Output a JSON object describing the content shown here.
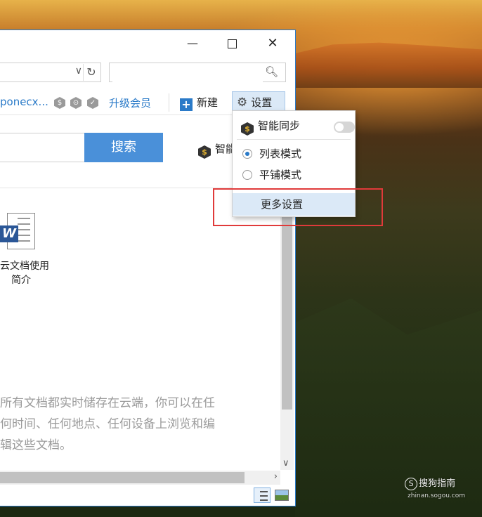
{
  "window": {
    "minimize_label": "—",
    "close_label": "✕"
  },
  "address_bar": {
    "value": "",
    "chevron": "∨",
    "refresh": "↻"
  },
  "search_bar": {
    "value": "",
    "placeholder": "",
    "icon": "search-icon"
  },
  "toolbar": {
    "user_name": "poneсx...",
    "badges": [
      "$",
      "⊙",
      "✓"
    ],
    "upgrade_label": "升级会员",
    "new_label": "新建",
    "settings_label": "设置"
  },
  "main": {
    "search_button_label": "搜索",
    "smart_label_partial": "智能",
    "coin_symbol": "$"
  },
  "document": {
    "icon_letter": "W",
    "caption_line1": "云文档使用",
    "caption_line2": "简介"
  },
  "info": {
    "line1": "所有文档都实时储存在云端，你可以在任",
    "line2": "何时间、任何地点、任何设备上浏览和编",
    "line3": "辑这些文档。"
  },
  "dropdown": {
    "sync_label": "智能同步",
    "sync_enabled": false,
    "list_mode_label": "列表模式",
    "tile_mode_label": "平铺模式",
    "selected_mode": "列表模式",
    "more_settings_label": "更多设置"
  },
  "watermark": {
    "brand": "搜狗指南",
    "url": "zhinan.sogou.com",
    "logo": "S"
  },
  "colors": {
    "accent": "#2a7ac8",
    "search_button": "#4a90d9",
    "highlight_box": "#e03a3a"
  }
}
